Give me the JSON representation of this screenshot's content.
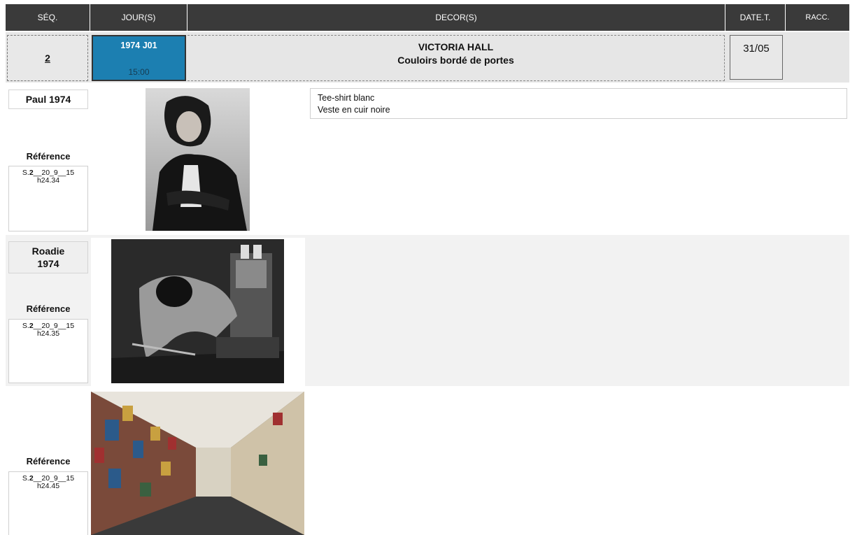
{
  "header": {
    "seq": "SÉQ.",
    "jours": "JOUR(S)",
    "decors": "DECOR(S)",
    "date_t": "DATE.T.",
    "racc": "RACC."
  },
  "scene": {
    "seq_number": "2",
    "jour_title": "1974 J01",
    "jour_time": "15:00",
    "decor_line1": "VICTORIA HALL",
    "decor_line2": "Couloirs bordé de portes",
    "date": "31/05",
    "jour_color": "#1c7fb1"
  },
  "entries": [
    {
      "name": "Paul 1974",
      "ref_label": "Référence",
      "ref_prefix": "S.",
      "ref_seq": "2",
      "ref_mid": "__20_9__15",
      "ref_line2": "h24.34",
      "costume": [
        "Tee-shirt blanc",
        "Veste en cuir noire"
      ]
    },
    {
      "name_line1": "Roadie",
      "name_line2": "1974",
      "ref_label": "Référence",
      "ref_prefix": "S.",
      "ref_seq": "2",
      "ref_mid": "__20_9__15",
      "ref_line2": "h24.35"
    },
    {
      "ref_label": "Référence",
      "ref_prefix": "S.",
      "ref_seq": "2",
      "ref_mid": "__20_9__15",
      "ref_line2": "h24.45"
    }
  ]
}
